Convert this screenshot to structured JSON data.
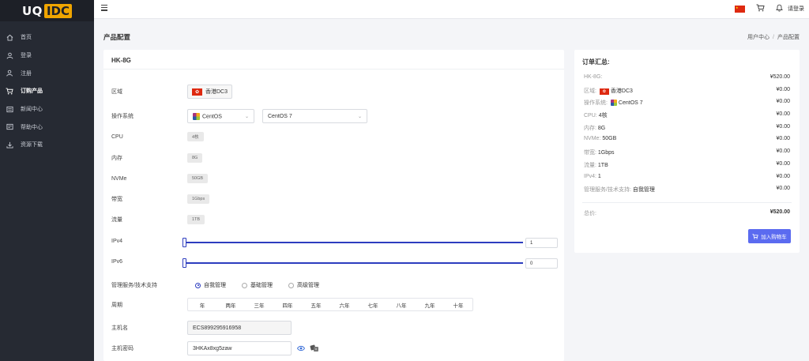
{
  "brand": {
    "part1": "UQ",
    "part2": "IDC"
  },
  "sidebar": {
    "items": [
      {
        "label": "首页",
        "icon": "home-icon"
      },
      {
        "label": "登录",
        "icon": "user-icon"
      },
      {
        "label": "注册",
        "icon": "user-add-icon"
      },
      {
        "label": "订购产品",
        "icon": "cart-icon",
        "active": true
      },
      {
        "label": "新闻中心",
        "icon": "news-icon"
      },
      {
        "label": "帮助中心",
        "icon": "help-icon"
      },
      {
        "label": "资源下载",
        "icon": "download-icon"
      }
    ]
  },
  "topbar": {
    "login_label": "请登录"
  },
  "page": {
    "title": "产品配置",
    "breadcrumb": [
      "用户中心",
      "产品配置"
    ]
  },
  "product": {
    "name": "HK-8G",
    "labels": {
      "region": "区域",
      "os": "操作系统",
      "cpu": "CPU",
      "ram": "内存",
      "nvme": "NVMe",
      "bandwidth": "带宽",
      "traffic": "流量",
      "ipv4": "IPv4",
      "ipv6": "IPv6",
      "mgmt": "管理服务/技术支持",
      "period": "周期",
      "hostname": "主机名",
      "password": "主机密码"
    },
    "region": "香港DC3",
    "os_family": "CentOS",
    "os_version": "CentOS 7",
    "cpu": "4核",
    "ram": "8G",
    "nvme": "50GB",
    "bandwidth": "1Gbps",
    "traffic": "1TB",
    "ipv4": {
      "value": "1",
      "min": 1,
      "max": 10,
      "current": 1
    },
    "ipv6": {
      "value": "0",
      "min": 0,
      "max": 10,
      "current": 0
    },
    "mgmt_options": [
      {
        "label": "自我管理",
        "checked": true
      },
      {
        "label": "基础管理",
        "checked": false
      },
      {
        "label": "高级管理",
        "checked": false
      }
    ],
    "periods": [
      "年",
      "两年",
      "三年",
      "四年",
      "五年",
      "六年",
      "七年",
      "八年",
      "九年",
      "十年"
    ],
    "hostname": "ECS899295916958",
    "password": "3HKAx8xg5zaw"
  },
  "summary": {
    "title": "订单汇总:",
    "rows": [
      {
        "label": "HK-8G:",
        "value": "",
        "price": "¥520.00"
      },
      {
        "label": "区域:",
        "value": "香港DC3",
        "price": "¥0.00",
        "flag": true
      },
      {
        "label": "操作系统:",
        "value": "CentOS 7",
        "price": "¥0.00",
        "os": true
      },
      {
        "label": "CPU:",
        "value": "4核",
        "price": "¥0.00"
      },
      {
        "label": "内存:",
        "value": "8G",
        "price": "¥0.00"
      },
      {
        "label": "NVMe:",
        "value": "50GB",
        "price": "¥0.00"
      },
      {
        "label": "带宽:",
        "value": "1Gbps",
        "price": "¥0.00"
      },
      {
        "label": "流量:",
        "value": "1TB",
        "price": "¥0.00"
      },
      {
        "label": "IPv4:",
        "value": "1",
        "price": "¥0.00"
      },
      {
        "label": "管理服务/技术支持:",
        "value": "自我管理",
        "price": "¥0.00"
      }
    ],
    "total_label": "总价:",
    "total": "¥520.00",
    "cart_button": "加入购物车"
  }
}
